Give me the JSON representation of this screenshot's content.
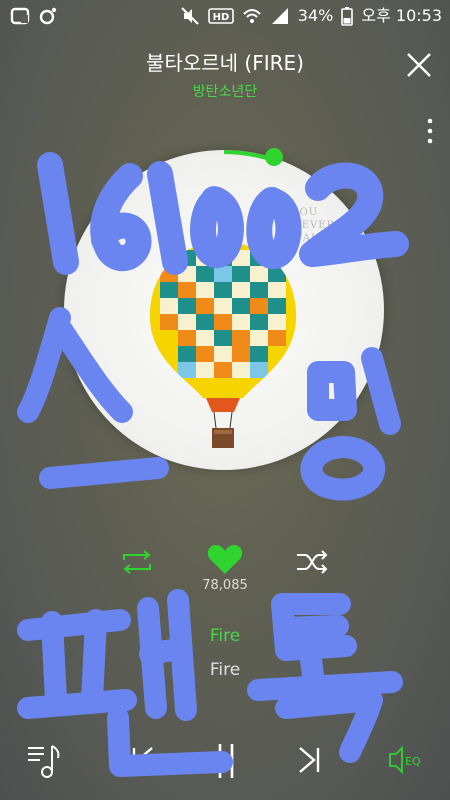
{
  "status_bar": {
    "left_icons": [
      "olleh-icon",
      "camera-dot-icon"
    ],
    "right_icons": [
      "mute-icon",
      "hd-icon",
      "wifi-icon",
      "signal-icon"
    ],
    "battery": "34%",
    "time": "오후 10:53"
  },
  "track": {
    "title": "불타오르네 (FIRE)",
    "artist": "방탄소년단",
    "elapsed": "0:19",
    "album_text": "YOU NEVER WALK ALONE"
  },
  "stats": {
    "like_count": "78,085"
  },
  "lyrics": {
    "current": "Fire",
    "next": "Fire"
  },
  "overlay": {
    "top_text": "161002",
    "left_text": "스",
    "right_text": "밍",
    "bottom_left_text": "팬",
    "bottom_right_text": "톡"
  },
  "colors": {
    "accent": "#2fd42f",
    "overlay": "#6a85f0"
  }
}
